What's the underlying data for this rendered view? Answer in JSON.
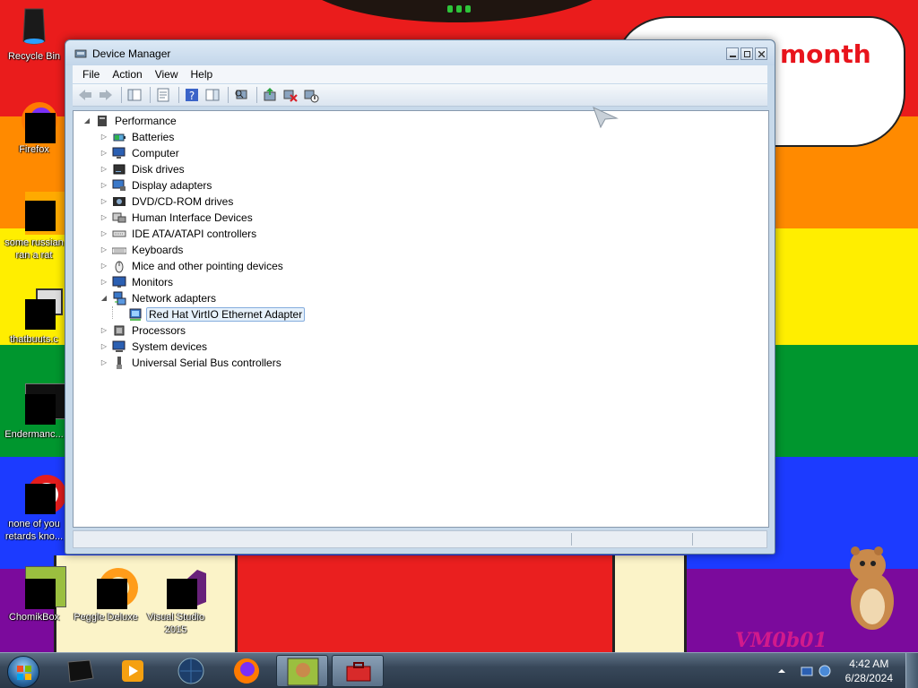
{
  "desktop": {
    "cloud_text": "month",
    "watermark": "VM0b01",
    "icons": [
      {
        "label": "Recycle Bin"
      },
      {
        "label": "Firefox"
      },
      {
        "label": "some russian ran a rat"
      },
      {
        "label": "thatbuuts.c"
      },
      {
        "label": "Endermanc..."
      },
      {
        "label": "none of you retards kno..."
      },
      {
        "label": "ChomikBox"
      },
      {
        "label": "Peggle Deluxe"
      },
      {
        "label": "Visual Studio 2015"
      }
    ]
  },
  "window": {
    "title": "Device Manager",
    "menu": [
      "File",
      "Action",
      "View",
      "Help"
    ]
  },
  "tree": {
    "root": "Performance",
    "categories": [
      {
        "label": "Batteries",
        "expanded": false
      },
      {
        "label": "Computer",
        "expanded": false
      },
      {
        "label": "Disk drives",
        "expanded": false
      },
      {
        "label": "Display adapters",
        "expanded": false
      },
      {
        "label": "DVD/CD-ROM drives",
        "expanded": false
      },
      {
        "label": "Human Interface Devices",
        "expanded": false
      },
      {
        "label": "IDE ATA/ATAPI controllers",
        "expanded": false
      },
      {
        "label": "Keyboards",
        "expanded": false
      },
      {
        "label": "Mice and other pointing devices",
        "expanded": false
      },
      {
        "label": "Monitors",
        "expanded": false
      },
      {
        "label": "Network adapters",
        "expanded": true
      },
      {
        "label": "Processors",
        "expanded": false
      },
      {
        "label": "System devices",
        "expanded": false
      },
      {
        "label": "Universal Serial Bus controllers",
        "expanded": false
      }
    ],
    "network_child": "Red Hat VirtIO Ethernet Adapter"
  },
  "taskbar": {
    "time": "4:42 AM",
    "date": "6/28/2024"
  },
  "colors": {
    "red": "#ea1c1c",
    "orange": "#ff8a00",
    "yellow": "#ffee00",
    "green": "#00962e",
    "blue": "#1c3bff",
    "purple": "#7b0a9c"
  }
}
